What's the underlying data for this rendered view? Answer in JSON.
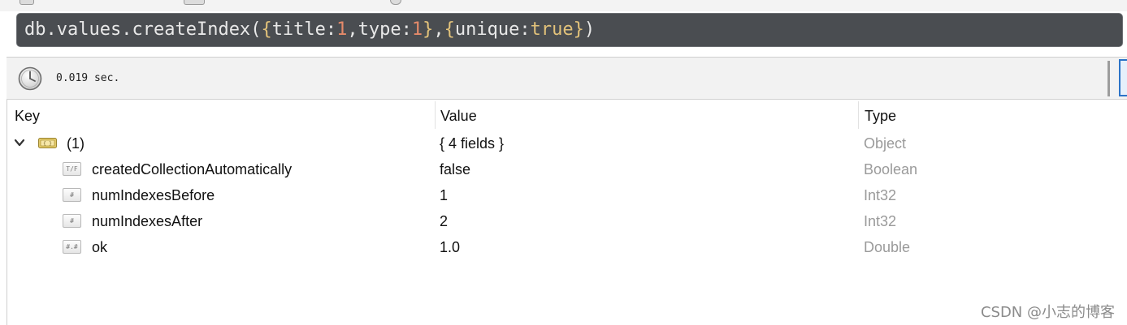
{
  "query": {
    "tokens": [
      {
        "text": "db",
        "kind": "key"
      },
      {
        "text": ".",
        "kind": "punct"
      },
      {
        "text": "values",
        "kind": "key"
      },
      {
        "text": ".",
        "kind": "punct"
      },
      {
        "text": "createIndex",
        "kind": "key"
      },
      {
        "text": "(",
        "kind": "punct"
      },
      {
        "text": "{",
        "kind": "bracket"
      },
      {
        "text": "title",
        "kind": "key"
      },
      {
        "text": ":",
        "kind": "punct"
      },
      {
        "text": "1",
        "kind": "num"
      },
      {
        "text": ",",
        "kind": "punct"
      },
      {
        "text": "type",
        "kind": "key"
      },
      {
        "text": ":",
        "kind": "punct"
      },
      {
        "text": "1",
        "kind": "num"
      },
      {
        "text": "}",
        "kind": "bracket"
      },
      {
        "text": ",",
        "kind": "punct"
      },
      {
        "text": "{",
        "kind": "bracket"
      },
      {
        "text": "unique",
        "kind": "key"
      },
      {
        "text": ":",
        "kind": "punct"
      },
      {
        "text": "true",
        "kind": "bool"
      },
      {
        "text": "}",
        "kind": "bracket"
      },
      {
        "text": ")",
        "kind": "punct"
      }
    ]
  },
  "status": {
    "time": "0.019 sec.",
    "clock_icon": "clock-icon"
  },
  "columns": {
    "key": "Key",
    "value": "Value",
    "type": "Type"
  },
  "root_row": {
    "key": "(1)",
    "value": "{ 4 fields }",
    "type": "Object",
    "expanded": true,
    "icon": "object-icon"
  },
  "fields": [
    {
      "key": "createdCollectionAutomatically",
      "value": "false",
      "type": "Boolean",
      "icon_glyph": "T/F"
    },
    {
      "key": "numIndexesBefore",
      "value": "1",
      "type": "Int32",
      "icon_glyph": "#"
    },
    {
      "key": "numIndexesAfter",
      "value": "2",
      "type": "Int32",
      "icon_glyph": "#"
    },
    {
      "key": "ok",
      "value": "1.0",
      "type": "Double",
      "icon_glyph": "#.#"
    }
  ],
  "watermark": "CSDN @小志的博客",
  "colors": {
    "query_bg": "#4a4d51",
    "type_text": "#9a9a9a",
    "accent": "#2b73c7"
  }
}
